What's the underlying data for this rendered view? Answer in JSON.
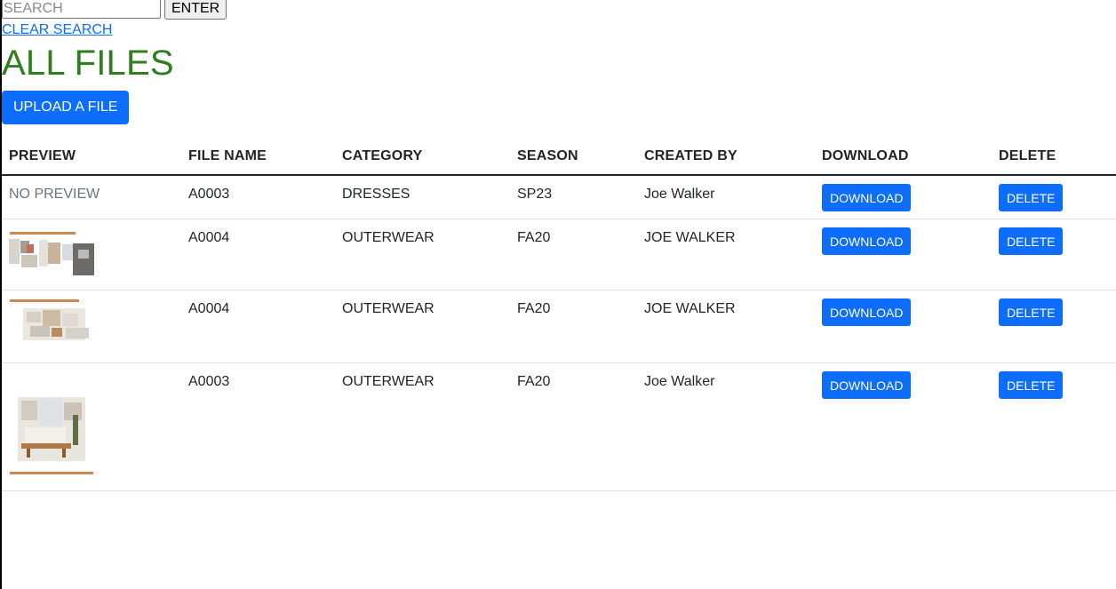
{
  "search": {
    "placeholder": "SEARCH",
    "enter_label": "ENTER",
    "clear_label": "CLEAR SEARCH"
  },
  "page": {
    "title": "ALL FILES",
    "upload_label": "UPLOAD A FILE"
  },
  "colors": {
    "title_green": "#2e7d1f",
    "primary_blue": "#0d6efd",
    "thumbnail_accent": "#c98a4b"
  },
  "table": {
    "headers": [
      "PREVIEW",
      "FILE NAME",
      "CATEGORY",
      "SEASON",
      "CREATED BY",
      "DOWNLOAD",
      "DELETE"
    ],
    "rows": [
      {
        "preview": "NO PREVIEW",
        "file_name": "A0003",
        "category": "DRESSES",
        "season": "SP23",
        "created_by": "Joe Walker",
        "download": "DOWNLOAD",
        "delete": "DELETE"
      },
      {
        "preview": "image-thumbnail",
        "file_name": "A0004",
        "category": "OUTERWEAR",
        "season": "FA20",
        "created_by": "JOE WALKER",
        "download": "DOWNLOAD",
        "delete": "DELETE"
      },
      {
        "preview": "image-thumbnail",
        "file_name": "A0004",
        "category": "OUTERWEAR",
        "season": "FA20",
        "created_by": "JOE WALKER",
        "download": "DOWNLOAD",
        "delete": "DELETE"
      },
      {
        "preview": "image-thumbnail",
        "file_name": "A0003",
        "category": "OUTERWEAR",
        "season": "FA20",
        "created_by": "Joe Walker",
        "download": "DOWNLOAD",
        "delete": "DELETE"
      }
    ]
  }
}
